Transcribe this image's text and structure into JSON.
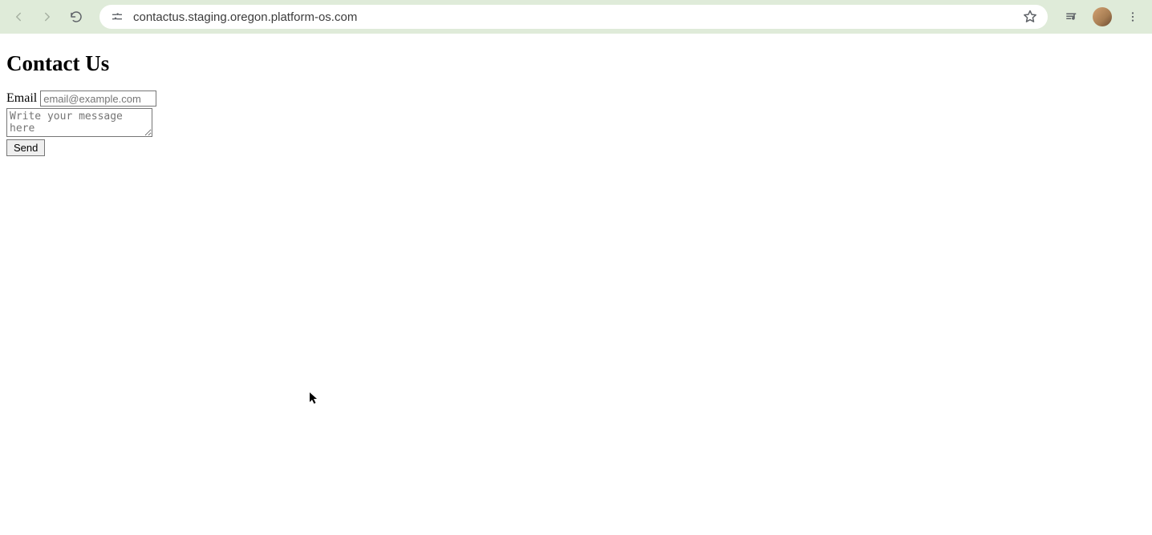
{
  "browser": {
    "url": "contactus.staging.oregon.platform-os.com"
  },
  "page": {
    "heading": "Contact Us",
    "form": {
      "email_label": "Email",
      "email_placeholder": "email@example.com",
      "message_placeholder": "Write your message here",
      "submit_label": "Send"
    }
  }
}
